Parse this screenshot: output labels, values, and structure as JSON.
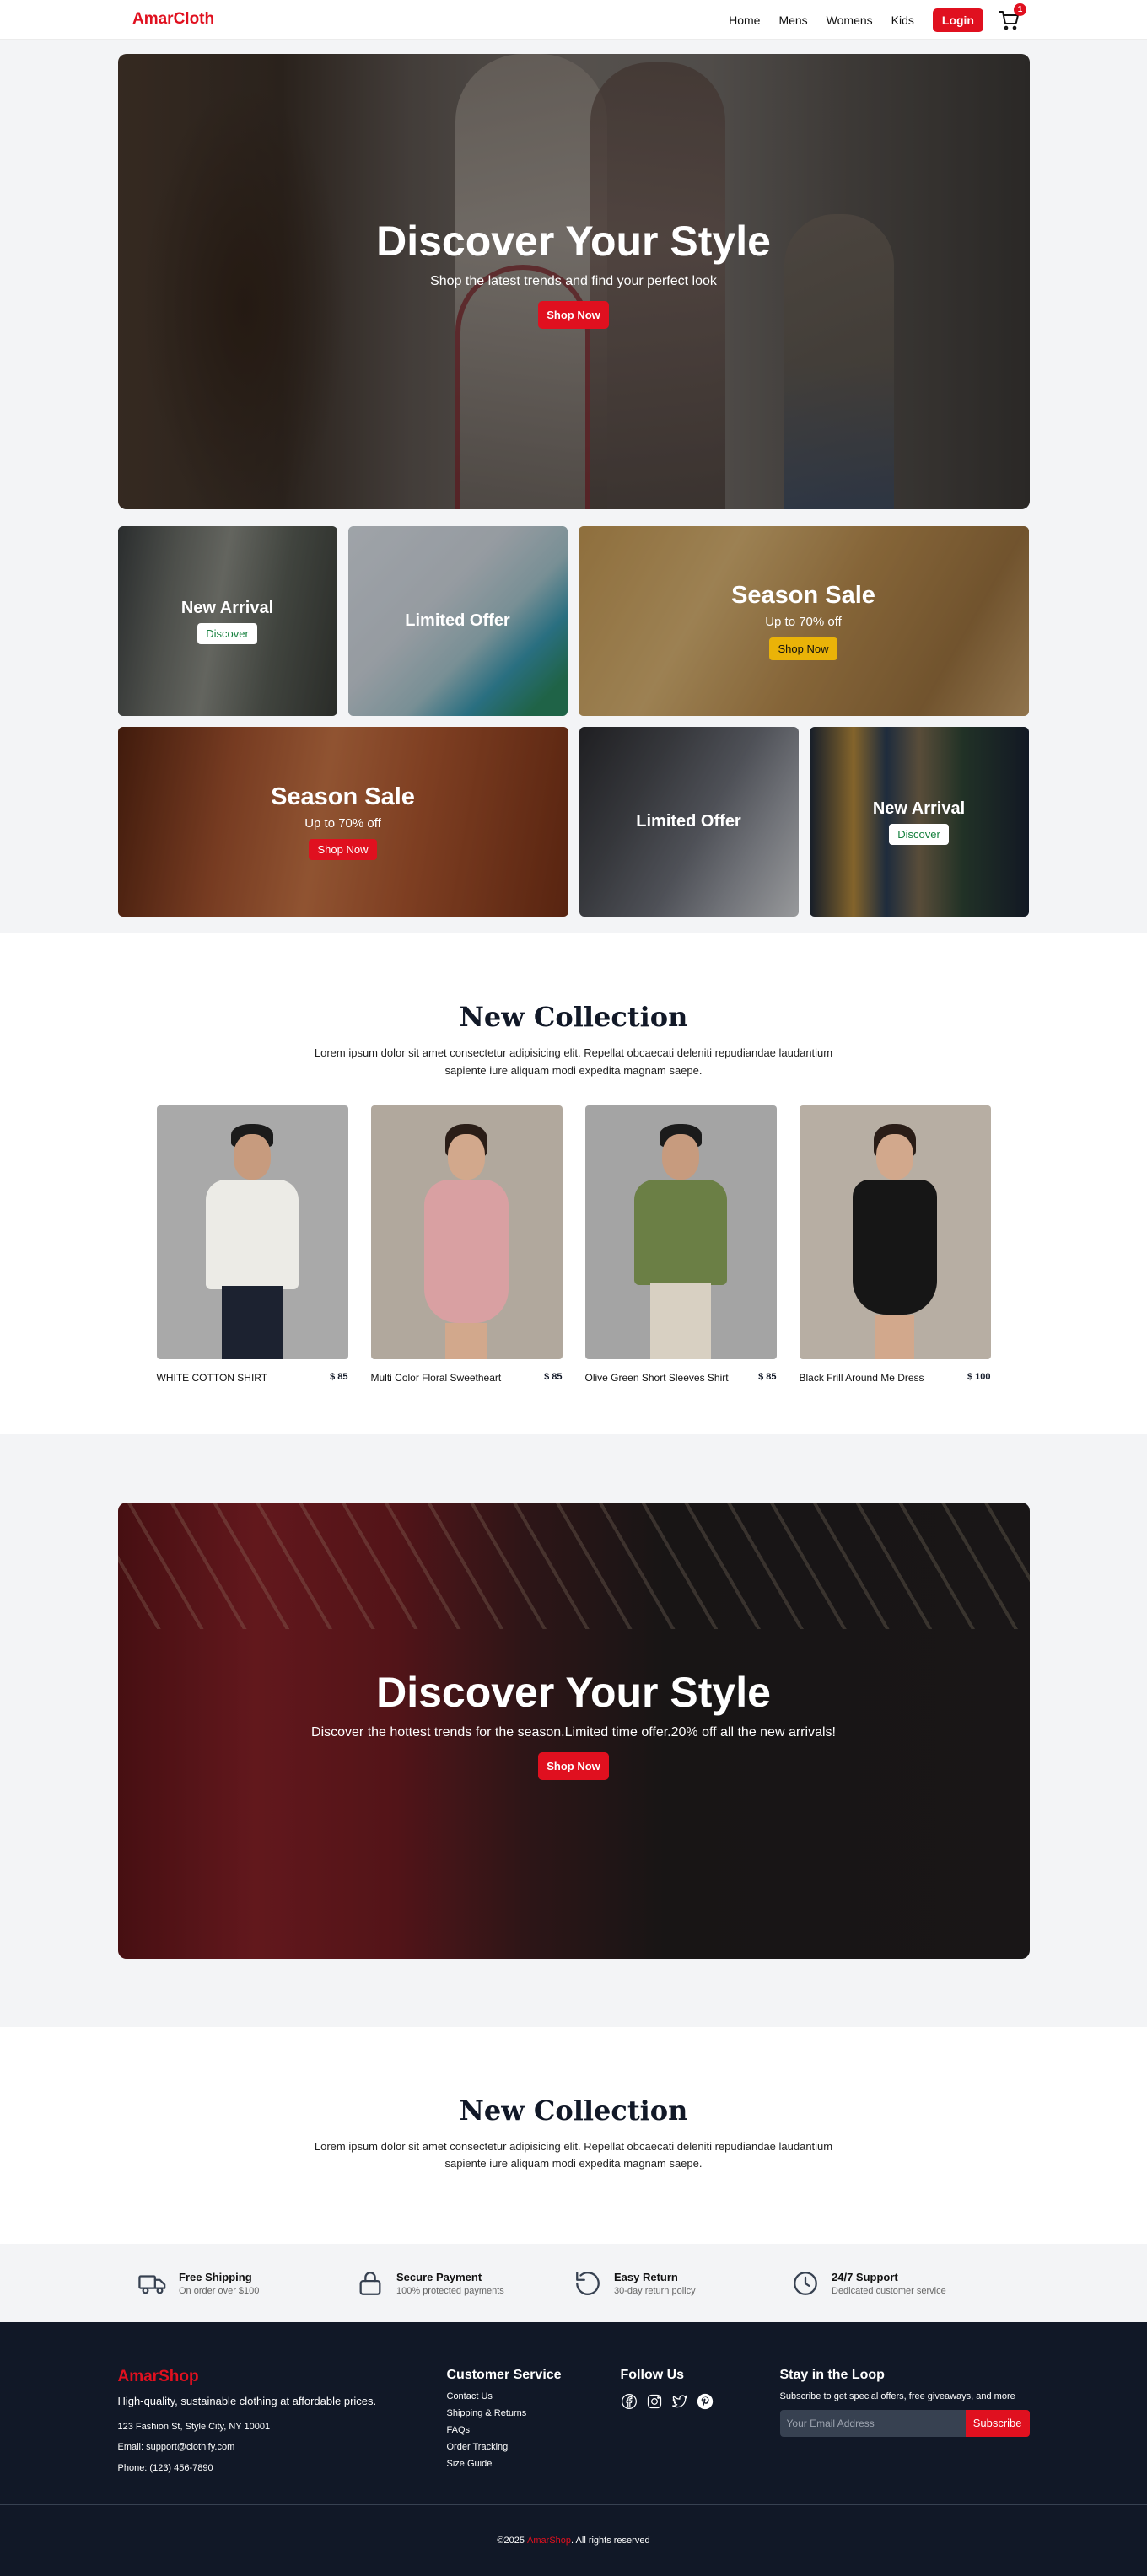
{
  "nav": {
    "logo": "AmarCloth",
    "links": [
      "Home",
      "Mens",
      "Womens",
      "Kids"
    ],
    "login": "Login",
    "cart_count": "1"
  },
  "hero": {
    "title": "Discover Your Style",
    "subtitle": "Shop the latest trends and find your perfect look",
    "cta": "Shop Now"
  },
  "promos": [
    {
      "title": "New Arrival",
      "button": "Discover"
    },
    {
      "title": "Limited Offer"
    },
    {
      "title": "Season Sale",
      "subtitle": "Up to 70% off",
      "button": "Shop Now"
    },
    {
      "title": "Season Sale",
      "subtitle": "Up to 70% off",
      "button": "Shop Now"
    },
    {
      "title": "Limited Offer"
    },
    {
      "title": "New Arrival",
      "button": "Discover"
    }
  ],
  "collection": {
    "title": "New Collection",
    "description": "Lorem ipsum dolor sit amet consectetur adipisicing elit. Repellat obcaecati deleniti repudiandae laudantium sapiente iure aliquam modi expedita magnam saepe.",
    "products": [
      {
        "name": "WHITE COTTON SHIRT",
        "price": "$ 85"
      },
      {
        "name": "Multi Color Floral Sweetheart",
        "price": "$ 85"
      },
      {
        "name": "Olive Green Short Sleeves Shirt",
        "price": "$ 85"
      },
      {
        "name": "Black Frill Around Me Dress",
        "price": "$ 100"
      }
    ]
  },
  "big_promo": {
    "title": "Discover Your Style",
    "subtitle": "Discover the hottest trends for the season.Limited time offer.20% off all the new arrivals!",
    "cta": "Shop Now"
  },
  "collection2": {
    "title": "New Collection",
    "description": "Lorem ipsum dolor sit amet consectetur adipisicing elit. Repellat obcaecati deleniti repudiandae laudantium sapiente iure aliquam modi expedita magnam saepe."
  },
  "features": [
    {
      "title": "Free Shipping",
      "subtitle": "On order over $100",
      "icon": "truck-icon"
    },
    {
      "title": "Secure Payment",
      "subtitle": "100% protected payments",
      "icon": "lock-icon"
    },
    {
      "title": "Easy Return",
      "subtitle": "30-day return policy",
      "icon": "return-icon"
    },
    {
      "title": "24/7 Support",
      "subtitle": "Dedicated customer service",
      "icon": "clock-icon"
    }
  ],
  "footer": {
    "logo": "AmarShop",
    "tagline": "High-quality, sustainable clothing at affordable prices.",
    "address": "123 Fashion St, Style City, NY 10001",
    "email": "Email: support@clothify.com",
    "phone": "Phone: (123) 456-7890",
    "service_title": "Customer Service",
    "service_links": [
      "Contact Us",
      "Shipping & Returns",
      "FAQs",
      "Order Tracking",
      "Size Guide"
    ],
    "follow_title": "Follow Us",
    "social_icons": [
      "facebook-icon",
      "instagram-icon",
      "twitter-icon",
      "pinterest-icon"
    ],
    "loop_title": "Stay in the Loop",
    "loop_sub": "Subscribe to get special offers, free giveaways, and more",
    "email_placeholder": "Your Email Address",
    "subscribe": "Subscribe",
    "copyright_pre": "©2025",
    "copyright_brand": "AmarShop",
    "copyright_post": ". All rights reserved"
  },
  "colors": {
    "accent": "#e0101f",
    "footer_bg": "#111827",
    "section_bg": "#f3f4f6"
  }
}
